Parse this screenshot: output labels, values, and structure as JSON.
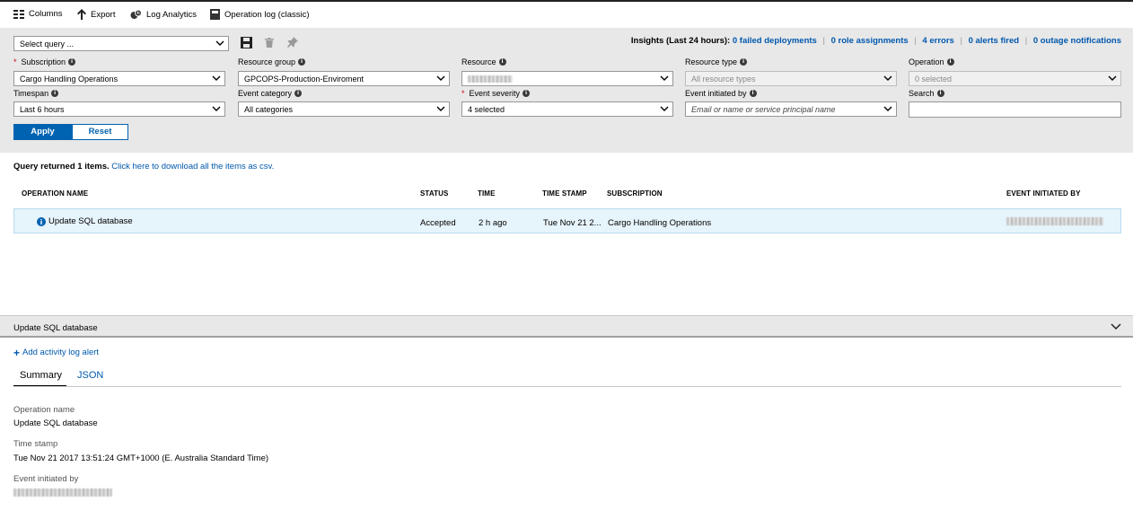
{
  "toolbar": {
    "columns": "Columns",
    "export": "Export",
    "log_analytics": "Log Analytics",
    "operation_log": "Operation log (classic)"
  },
  "query": {
    "select_value": "Select query ..."
  },
  "insights": {
    "prefix": "Insights (Last 24 hours):",
    "failed_deployments": "0 failed deployments",
    "role_assignments": "0 role assignments",
    "errors": "4 errors",
    "alerts_fired": "0 alerts fired",
    "outage_notifications": "0 outage notifications",
    "separator": "|"
  },
  "filters": {
    "subscription": {
      "label": "Subscription",
      "value": "Cargo Handling Operations",
      "required": "*"
    },
    "resource_group": {
      "label": "Resource group",
      "value": "GPCOPS-Production-Enviroment"
    },
    "resource": {
      "label": "Resource",
      "value": ""
    },
    "resource_type": {
      "label": "Resource type",
      "value": "All resource types"
    },
    "operation": {
      "label": "Operation",
      "value": "0 selected"
    },
    "timespan": {
      "label": "Timespan",
      "value": "Last 6 hours"
    },
    "event_category": {
      "label": "Event category",
      "value": "All categories"
    },
    "event_severity": {
      "label": "Event severity",
      "value": "4 selected",
      "required": "*"
    },
    "event_initiated_by": {
      "label": "Event initiated by",
      "placeholder": "Email or name or service principal name"
    },
    "search": {
      "label": "Search",
      "value": ""
    }
  },
  "buttons": {
    "apply": "Apply",
    "reset": "Reset"
  },
  "results": {
    "summary": "Query returned 1 items.",
    "download_link": "Click here to download all the items as csv."
  },
  "table": {
    "headers": {
      "operation_name": "OPERATION NAME",
      "status": "STATUS",
      "time": "TIME",
      "time_stamp": "TIME STAMP",
      "subscription": "SUBSCRIPTION",
      "event_initiated_by": "EVENT INITIATED BY"
    },
    "rows": [
      {
        "operation_name": "Update SQL database",
        "status": "Accepted",
        "time": "2 h ago",
        "time_stamp": "Tue Nov 21 2...",
        "subscription": "Cargo Handling Operations"
      }
    ]
  },
  "detail": {
    "title": "Update SQL database",
    "add_alert": "Add activity log alert",
    "tabs": {
      "summary": "Summary",
      "json": "JSON"
    },
    "operation_name_label": "Operation name",
    "operation_name_value": "Update SQL database",
    "time_stamp_label": "Time stamp",
    "time_stamp_value": "Tue Nov 21 2017 13:51:24 GMT+1000 (E. Australia Standard Time)",
    "event_initiated_by_label": "Event initiated by"
  },
  "colors": {
    "accent": "#0063b1",
    "link": "#0058ad",
    "filter_bg": "#e8e8e8",
    "selected_row": "#e6f4fb",
    "required": "#d0021b"
  }
}
